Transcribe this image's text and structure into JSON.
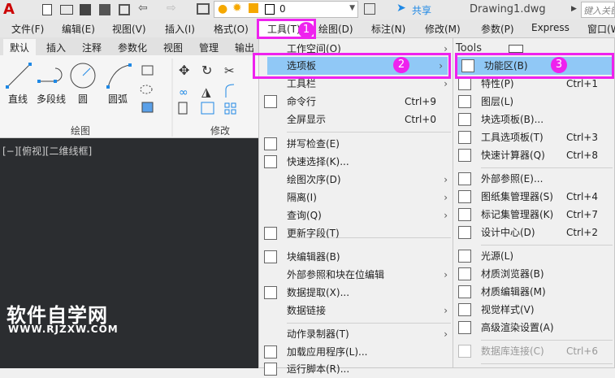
{
  "titlebar": {
    "layer_value": "0",
    "share": "共享",
    "doc_title": "Drawing1.dwg",
    "search_placeholder": "键入关键"
  },
  "menubar": [
    "文件(F)",
    "编辑(E)",
    "视图(V)",
    "插入(I)",
    "格式(O)",
    "工具(T)",
    "绘图(D)",
    "标注(N)",
    "修改(M)",
    "参数(P)",
    "Express",
    "窗口(W"
  ],
  "ribbon_tabs": [
    "默认",
    "插入",
    "注释",
    "参数化",
    "视图",
    "管理",
    "输出"
  ],
  "ribbon": {
    "tools": [
      "直线",
      "多段线",
      "圆",
      "圆弧"
    ],
    "draw_panel": "绘图",
    "modify_panel": "修改"
  },
  "viewport_label": "[−][俯视][二维线框]",
  "watermark": {
    "cn": "软件自学网",
    "url": "WWW.RJZXW.COM"
  },
  "tools_menu": [
    {
      "label": "工作空间(O)",
      "arrow": true
    },
    {
      "label": "选项板",
      "arrow": true,
      "highlight": true
    },
    {
      "label": "工具栏",
      "arrow": true
    },
    {
      "label": "命令行",
      "shortcut": "Ctrl+9"
    },
    {
      "label": "全屏显示",
      "shortcut": "Ctrl+0"
    },
    {
      "label": "拼写检查(E)"
    },
    {
      "label": "快速选择(K)..."
    },
    {
      "label": "绘图次序(D)",
      "arrow": true
    },
    {
      "label": "隔离(I)",
      "arrow": true
    },
    {
      "label": "查询(Q)",
      "arrow": true
    },
    {
      "label": "更新字段(T)"
    },
    {
      "label": "块编辑器(B)"
    },
    {
      "label": "外部参照和块在位编辑",
      "arrow": true
    },
    {
      "label": "数据提取(X)..."
    },
    {
      "label": "数据链接",
      "arrow": true
    },
    {
      "label": "动作录制器(T)",
      "arrow": true
    },
    {
      "label": "加载应用程序(L)..."
    },
    {
      "label": "运行脚本(R)..."
    }
  ],
  "palettes_menu": {
    "header": "Tools",
    "items": [
      {
        "label": "功能区(B)",
        "highlight": true
      },
      {
        "label": "特性(P)",
        "shortcut": "Ctrl+1"
      },
      {
        "label": "图层(L)"
      },
      {
        "label": "块选项板(B)..."
      },
      {
        "label": "工具选项板(T)",
        "shortcut": "Ctrl+3"
      },
      {
        "label": "快速计算器(Q)",
        "shortcut": "Ctrl+8"
      },
      {
        "label": "外部参照(E)..."
      },
      {
        "label": "图纸集管理器(S)",
        "shortcut": "Ctrl+4"
      },
      {
        "label": "标记集管理器(K)",
        "shortcut": "Ctrl+7"
      },
      {
        "label": "设计中心(D)",
        "shortcut": "Ctrl+2"
      },
      {
        "label": "光源(L)"
      },
      {
        "label": "材质浏览器(B)"
      },
      {
        "label": "材质编辑器(M)"
      },
      {
        "label": "视觉样式(V)"
      },
      {
        "label": "高级渲染设置(A)"
      },
      {
        "label": "数据库连接(C)",
        "shortcut": "Ctrl+6",
        "disabled": true
      }
    ]
  },
  "annotations": [
    "1",
    "2",
    "3"
  ],
  "colors": {
    "highlight": "#90c8f6",
    "annotation": "#ee22ee",
    "canvas": "#2b2d30"
  }
}
